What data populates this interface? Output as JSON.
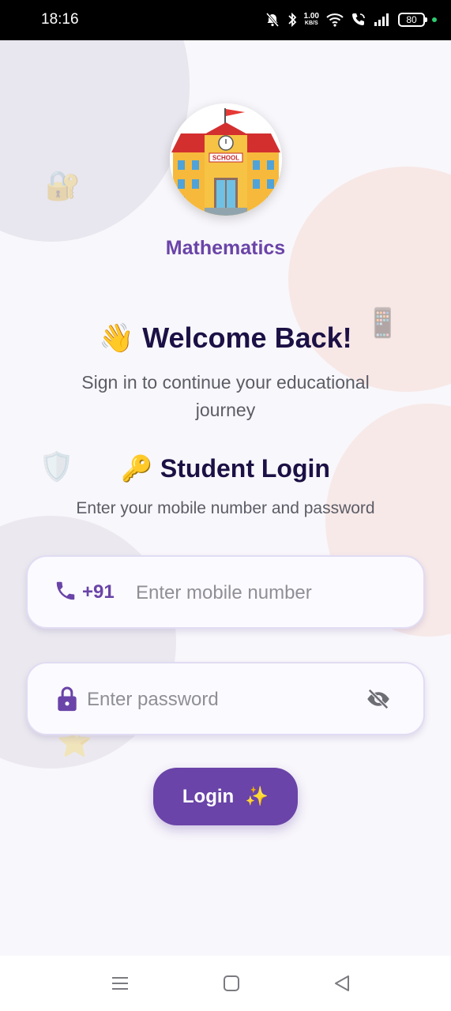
{
  "status_bar": {
    "time": "18:16",
    "net_speed_value": "1.00",
    "net_speed_unit": "KB/S",
    "battery": "80"
  },
  "app": {
    "subject": "Mathematics",
    "logo_sign": "SCHOOL",
    "welcome_emoji": "👋",
    "welcome_title": "Welcome Back!",
    "welcome_subtitle": "Sign in to continue your educational journey",
    "login_emoji": "🔑",
    "login_title": "Student Login",
    "login_subtitle": "Enter your mobile number and password",
    "phone": {
      "country_code": "+91",
      "placeholder": "Enter mobile number",
      "value": ""
    },
    "password": {
      "placeholder": "Enter password",
      "value": ""
    },
    "login_button": "Login",
    "login_button_emoji": "✨",
    "decorations": [
      "🔐",
      "📱",
      "🛡️",
      "⭐"
    ]
  },
  "colors": {
    "accent": "#6a44a8",
    "title": "#1c1145",
    "background": "#f8f7fb"
  },
  "navbar": {
    "icons": [
      "menu-icon",
      "home-square-icon",
      "back-triangle-icon"
    ]
  }
}
